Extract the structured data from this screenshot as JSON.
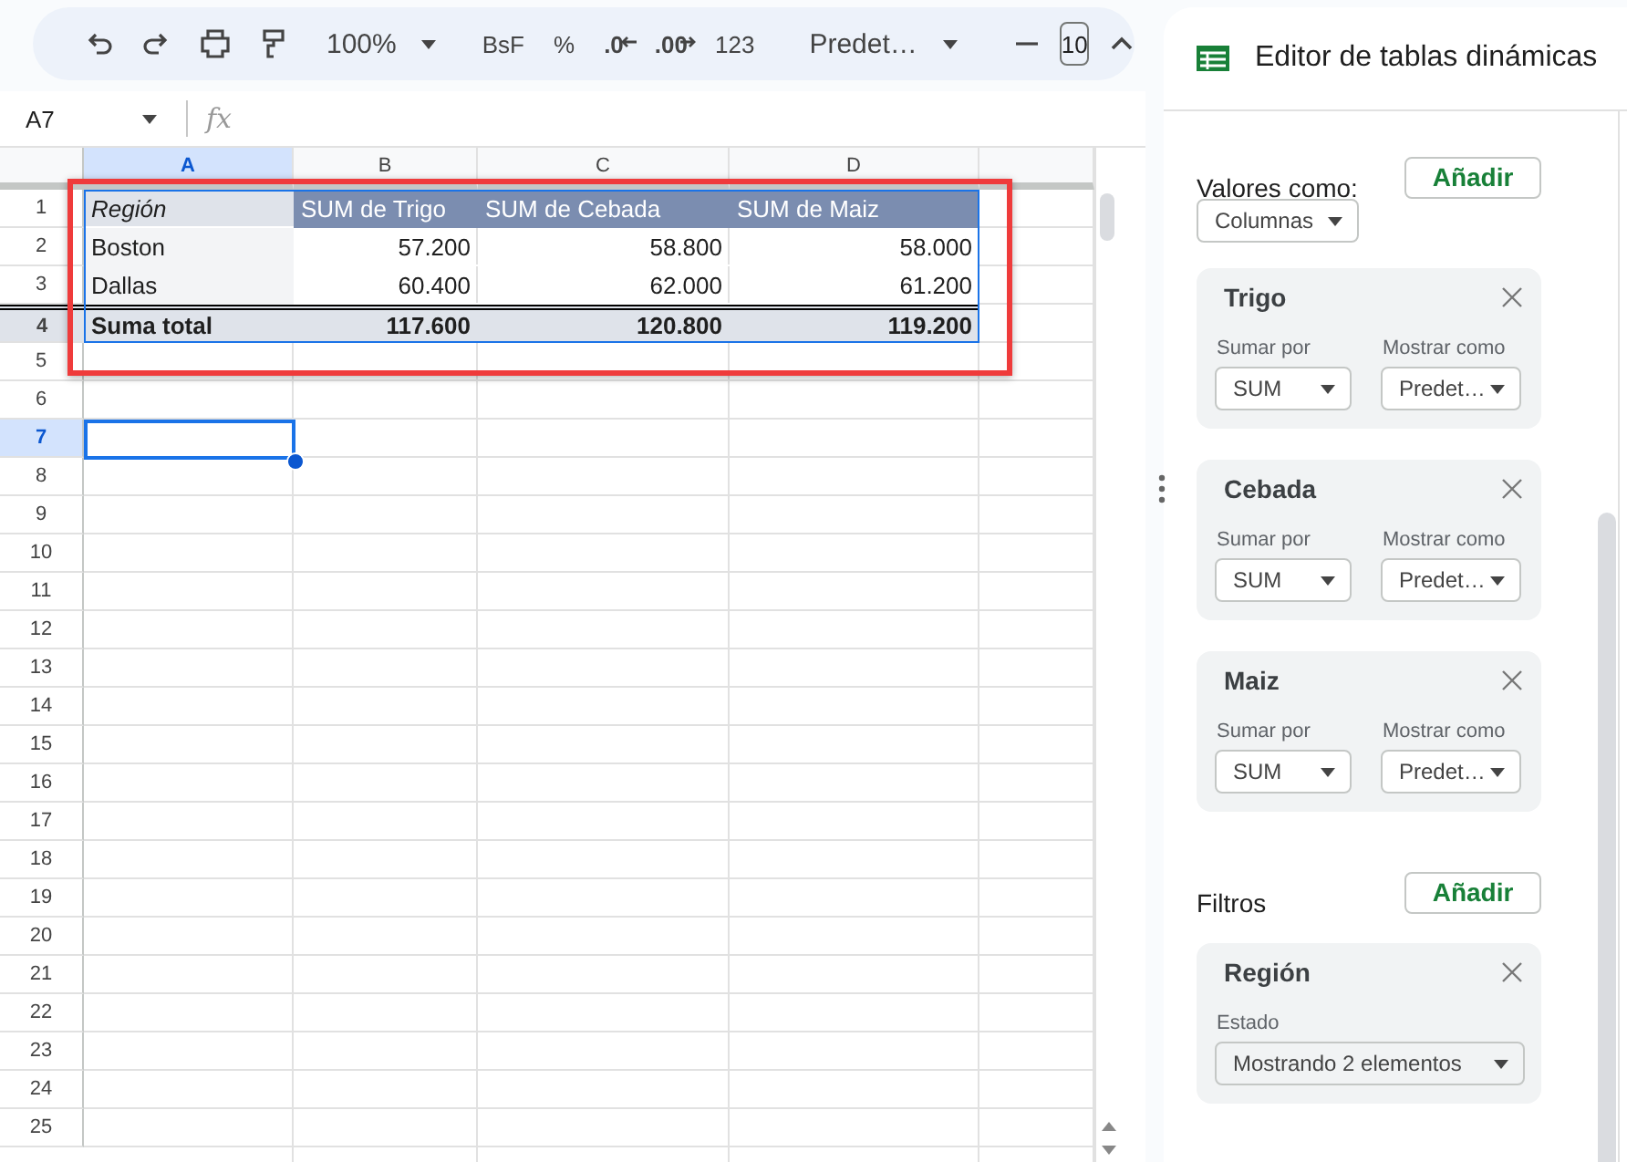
{
  "toolbar": {
    "zoom": "100%",
    "format_buttons": [
      {
        "label": "BsF",
        "kind": "text"
      },
      {
        "label": "%",
        "kind": "text"
      },
      {
        "label": ".0",
        "kind": "decrease"
      },
      {
        "label": ".00",
        "kind": "increase"
      },
      {
        "label": "123",
        "kind": "text"
      }
    ],
    "font": "Predet…",
    "font_size": "10"
  },
  "formula_bar": {
    "name_box": "A7",
    "fx": "fx"
  },
  "sheet": {
    "columns": [
      {
        "label": "A",
        "selected": true
      },
      {
        "label": "B",
        "selected": false
      },
      {
        "label": "C",
        "selected": false
      },
      {
        "label": "D",
        "selected": false
      }
    ],
    "rows": [
      {
        "number": "1",
        "selected": false,
        "kind": "header",
        "cells": [
          "Región",
          "SUM de Trigo",
          "SUM de Cebada",
          "SUM de Maiz"
        ]
      },
      {
        "number": "2",
        "selected": false,
        "kind": "data",
        "cells": [
          "Boston",
          "57.200",
          "58.800",
          "58.000"
        ]
      },
      {
        "number": "3",
        "selected": false,
        "kind": "data",
        "cells": [
          "Dallas",
          "60.400",
          "62.000",
          "61.200"
        ]
      },
      {
        "number": "4",
        "selected": false,
        "kind": "total",
        "cells": [
          "Suma total",
          "117.600",
          "120.800",
          "119.200"
        ]
      },
      {
        "number": "5",
        "selected": false
      },
      {
        "number": "6",
        "selected": false
      },
      {
        "number": "7",
        "selected": true
      },
      {
        "number": "8",
        "selected": false
      },
      {
        "number": "9",
        "selected": false
      },
      {
        "number": "10",
        "selected": false
      },
      {
        "number": "11",
        "selected": false
      },
      {
        "number": "12",
        "selected": false
      },
      {
        "number": "13",
        "selected": false
      },
      {
        "number": "14",
        "selected": false
      },
      {
        "number": "15",
        "selected": false
      },
      {
        "number": "16",
        "selected": false
      },
      {
        "number": "17",
        "selected": false
      },
      {
        "number": "18",
        "selected": false
      },
      {
        "number": "19",
        "selected": false
      },
      {
        "number": "20",
        "selected": false
      },
      {
        "number": "21",
        "selected": false
      },
      {
        "number": "22",
        "selected": false
      },
      {
        "number": "23",
        "selected": false
      },
      {
        "number": "24",
        "selected": false
      },
      {
        "number": "25",
        "selected": false
      }
    ]
  },
  "panel": {
    "title": "Editor de tablas dinámicas",
    "values": {
      "label": "Valores como:",
      "add": "Añadir",
      "layout": "Columnas",
      "cards": [
        {
          "title": "Trigo",
          "summarize_label": "Sumar por",
          "summarize": "SUM",
          "show_label": "Mostrar como",
          "show": "Predet…"
        },
        {
          "title": "Cebada",
          "summarize_label": "Sumar por",
          "summarize": "SUM",
          "show_label": "Mostrar como",
          "show": "Predet…"
        },
        {
          "title": "Maiz",
          "summarize_label": "Sumar por",
          "summarize": "SUM",
          "show_label": "Mostrar como",
          "show": "Predet…"
        }
      ]
    },
    "filters": {
      "label": "Filtros",
      "add": "Añadir",
      "cards": [
        {
          "title": "Región",
          "status_label": "Estado",
          "status": "Mostrando 2 elementos"
        }
      ]
    }
  }
}
